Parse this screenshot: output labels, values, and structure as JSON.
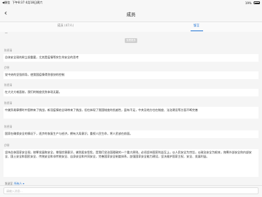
{
  "status": {
    "carrier": "◀微信",
    "time_date": "下午8:37  4月18日周六",
    "battery_pct": "19%"
  },
  "nav": {
    "back_icon": "chevron-left-icon",
    "title": "成员"
  },
  "tabs": [
    {
      "label": "成员 (47人)",
      "active": false
    },
    {
      "label": "留言",
      "active": true
    }
  ],
  "small_mark": "—",
  "more_button": "查看更多",
  "messages": [
    {
      "sender": "陈德清",
      "text": "总体安全观的树立很重要，尤其是疫情等突生命安全的思考"
    },
    {
      "sender": "伊寒",
      "text": "党中央的坚强领导，使我国疫情得到很快的控制"
    },
    {
      "sender": "陈德清",
      "text": "在大灾大难面前，我们的制度优势体现无疑。"
    },
    {
      "sender": "陈德清",
      "text": "中美贸易摩擦时中国带来了挑战，新冠疫情给全球带来了挑战，但也体现了我国制度的优越性，虽有不足，中央及地方也在制度、法治建设等方面不断完善"
    },
    {
      "sender": "陈德清",
      "text": "国家在确保安全的情况下，逐步的恢复生产与经济，拥有大局意识，重视人民生命，将人民放在前面。"
    },
    {
      "sender": "伊寒",
      "text": "坚持总体国家安全观，统筹发展和安全，增强忧患意识，做到居安思危，是我们党治国理政的一个重大原则。必须坚持国家利益至上，以人民安全为宗旨，以政治安全为根本，统筹外部安全和内部安全、国土安全和国民安全、传统安全和非传统安全、自身安全和共同安全，完善国家安全制度体系，加强国家安全能力建设，坚决维护国家主权、安全、发展利益。"
    }
  ],
  "footer": {
    "label": "发送至",
    "recipient": "所有人",
    "chevron_icon": "chevron-down-icon"
  },
  "input": {
    "placeholder": "请输入消息..."
  }
}
